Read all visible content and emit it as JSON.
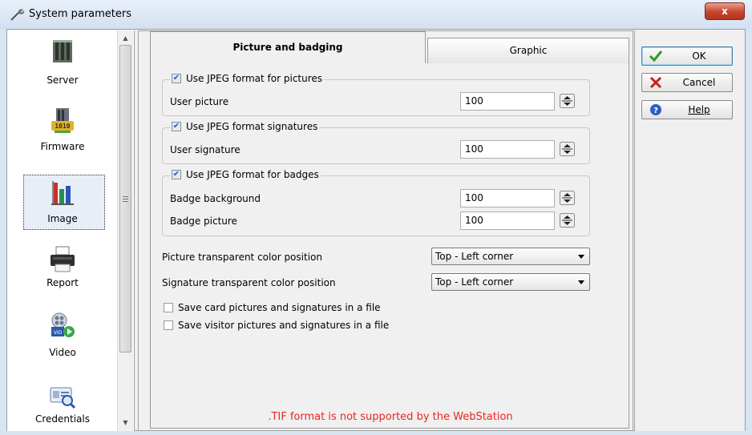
{
  "window": {
    "title": "System parameters",
    "close_label": "x"
  },
  "sidebar": {
    "items": [
      {
        "label": "Server",
        "icon": "server-icon"
      },
      {
        "label": "Firmware",
        "icon": "firmware-icon"
      },
      {
        "label": "Image",
        "icon": "image-chart-icon",
        "selected": true
      },
      {
        "label": "Report",
        "icon": "printer-icon"
      },
      {
        "label": "Video",
        "icon": "video-icon"
      },
      {
        "label": "Credentials",
        "icon": "credentials-icon"
      }
    ]
  },
  "tabs": [
    {
      "label": "Picture and badging",
      "active": true
    },
    {
      "label": "Graphic",
      "active": false
    }
  ],
  "groups": {
    "pictures": {
      "checkbox_label": "Use JPEG format for pictures",
      "checked": true,
      "rows": [
        {
          "label": "User picture",
          "value": "100"
        }
      ]
    },
    "signatures": {
      "checkbox_label": "Use JPEG format signatures",
      "checked": true,
      "rows": [
        {
          "label": "User signature",
          "value": "100"
        }
      ]
    },
    "badges": {
      "checkbox_label": "Use JPEG format for badges",
      "checked": true,
      "rows": [
        {
          "label": "Badge background",
          "value": "100"
        },
        {
          "label": "Badge picture",
          "value": "100"
        }
      ]
    }
  },
  "dropdowns": [
    {
      "label": "Picture transparent color position",
      "value": "Top - Left corner"
    },
    {
      "label": "Signature transparent color position",
      "value": "Top - Left corner"
    }
  ],
  "options": [
    {
      "label": "Save card pictures and signatures in a file",
      "checked": false
    },
    {
      "label": "Save visitor pictures and signatures in a file",
      "checked": false
    }
  ],
  "warning": ".TIF format is not supported by the WebStation",
  "buttons": {
    "ok": "OK",
    "cancel": "Cancel",
    "help": "Help"
  },
  "colors": {
    "warning": "#e8261e",
    "ok_check": "#2e9d22",
    "cancel_x": "#c8201a",
    "help_blue": "#2b5fc4"
  }
}
